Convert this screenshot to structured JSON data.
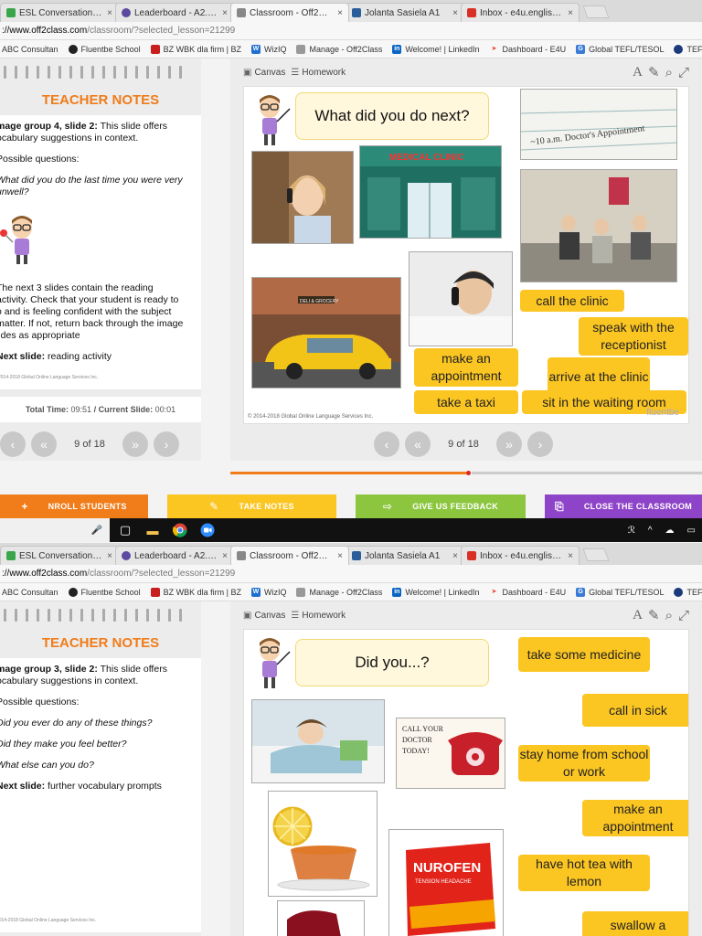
{
  "tabs": [
    {
      "title": "ESL Conversation lesson on s",
      "close": "×",
      "icon_color": "#3aa64a",
      "icon": "iSL"
    },
    {
      "title": "Leaderboard - A2.2 Fluen",
      "close": "×",
      "icon_color": "#5b4aa0",
      "icon": "m"
    },
    {
      "title": "Classroom - Off2Class",
      "close": "×",
      "icon_color": "#777777",
      "icon": "|||▸"
    },
    {
      "title": "Jolanta Sasiela A1",
      "close": "×",
      "icon_color": "#2a5d9a",
      "icon": "J"
    },
    {
      "title": "Inbox - e4u.englishforyou",
      "close": "×",
      "icon_color": "#d93025",
      "icon": "M"
    }
  ],
  "address": {
    "host": "://www.off2class.com",
    "path": "/classroom/?selected_lesson=21299"
  },
  "bookmarks": [
    {
      "label": "ABC Consultan",
      "icon": "",
      "color": "#888888"
    },
    {
      "label": "Fluentbe School",
      "icon": "◐",
      "color": "#222222"
    },
    {
      "label": "BZ WBK dla firm | BZ",
      "icon": "■",
      "color": "#c81e1e"
    },
    {
      "label": "WizIQ",
      "icon": "W",
      "color": "#1f6fd1"
    },
    {
      "label": "Manage - Off2Class",
      "icon": "|||▸",
      "color": "#888888"
    },
    {
      "label": "Welcome! | LinkedIn",
      "icon": "in",
      "color": "#0a66c2"
    },
    {
      "label": "Dashboard - E4U",
      "icon": "➤",
      "color": "#e8412c"
    },
    {
      "label": "Global TEFL/TESOL",
      "icon": "G",
      "color": "#3a7bd5"
    },
    {
      "label": "TEFL with CELTA",
      "icon": "●",
      "color": "#1a3a7a"
    }
  ],
  "toolbar": {
    "canvas": "Canvas",
    "homework": "Homework",
    "font_icon": "A",
    "pencil_icon": "✎",
    "search_icon": "⌕",
    "expand_icon": "⤢"
  },
  "teacher_notes_title": "TEACHER NOTES",
  "screen1": {
    "notes": {
      "p1_bold": "mage group 4, slide 2:",
      "p1_rest": " This slide offers",
      "p1_line2": "ocabulary suggestions in context.",
      "p2": "Possible questions:",
      "p3_line1": "What did you do the last time you were very",
      "p3_line2": "unwell?",
      "p4_line1": "The next 3 slides contain the reading",
      "p4_line2": "activity. Check that your student is ready to",
      "p4_line3": "o and is feeling confident with the subject",
      "p4_line4": "matter. If not, return back through the image",
      "p4_line5": "lides as appropriate",
      "next_bold": "Next slide:",
      "next_rest": " reading activity",
      "copyright": "2014-2018 Global Online Language Services Inc."
    },
    "time": {
      "label_total": "Total Time:",
      "total": "09:51",
      "label_current": "/ Current Slide:",
      "current": "00:01"
    },
    "slide_count": "9 of 18",
    "slide": {
      "question": "What did you do next?",
      "cards": [
        "call the clinic",
        "speak with the receptionist",
        "make an appointment",
        "arrive at the clinic",
        "take a taxi",
        "sit in the waiting room"
      ],
      "copyright": "© 2014-2018 Global Online Language Services Inc.",
      "watermark": "fluentbe",
      "note_text": "~10 a.m. Doctor's Appointment",
      "clinic_sign": "MEDICAL CLINIC",
      "deli_sign": "DELI & GROCERY"
    },
    "progress": 0.5
  },
  "footer": {
    "enroll": "NROLL STUDENTS",
    "notes": "TAKE NOTES",
    "feedback": "GIVE US FEEDBACK",
    "close": "CLOSE THE CLASSROOM"
  },
  "taskbar": {
    "mic": "🎤",
    "tray_icons": [
      "ℛ",
      "^",
      "☁",
      "▭"
    ]
  },
  "screen2": {
    "notes": {
      "p1_bold": "mage group 3, slide 2:",
      "p1_rest": " This slide offers",
      "p1_line2": "ocabulary suggestions in context.",
      "p2": "Possible questions:",
      "q1": "Did you ever do any of these things?",
      "q2": "Did they make you feel better?",
      "q3": "What else can you do?",
      "next_bold": "Next slide:",
      "next_rest": " further vocabulary prompts",
      "copyright": "2014-2018 Global Online Language Services Inc."
    },
    "slide": {
      "question": "Did you...?",
      "cards": [
        "take some medicine",
        "call in sick",
        "stay home from school or work",
        "make an appointment",
        "have hot tea with lemon",
        "swallow a"
      ],
      "poster_text": "CALL YOUR DOCTOR TODAY!",
      "box_brand": "NUROFEN",
      "box_sub": "TENSION HEADACHE"
    }
  },
  "colors": {
    "orange": "#f07c1a",
    "yellow_card": "#fbc522",
    "enroll": "#f07c1a",
    "notes": "#fbc522",
    "feedback": "#8cc63f",
    "close": "#8e44c8"
  }
}
